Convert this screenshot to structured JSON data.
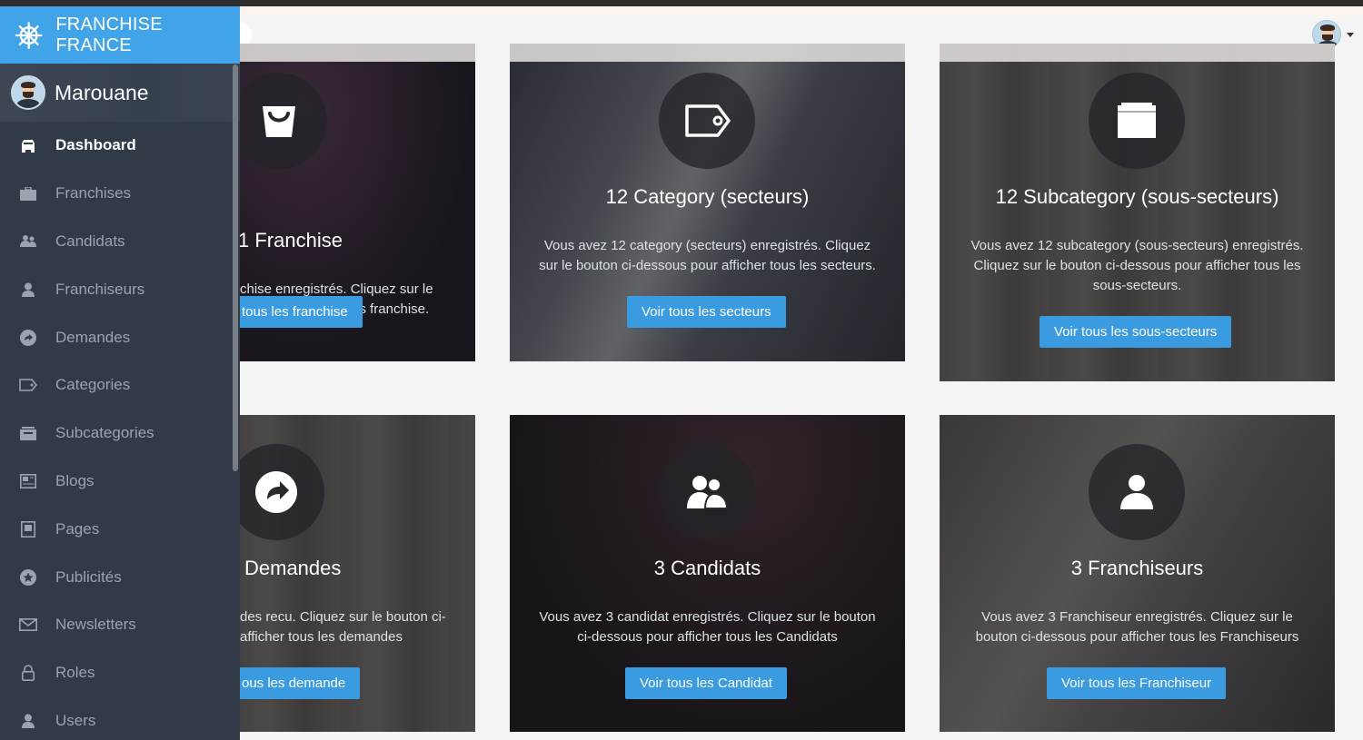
{
  "brand": {
    "name": "FRANCHISE FRANCE"
  },
  "user": {
    "name": "Marouane"
  },
  "nav": [
    {
      "label": "Dashboard",
      "icon": "dashboard-icon",
      "active": true
    },
    {
      "label": "Franchises",
      "icon": "briefcase-icon"
    },
    {
      "label": "Candidats",
      "icon": "users-icon"
    },
    {
      "label": "Franchiseurs",
      "icon": "user-icon"
    },
    {
      "label": "Demandes",
      "icon": "share-icon"
    },
    {
      "label": "Categories",
      "icon": "tag-icon"
    },
    {
      "label": "Subcategories",
      "icon": "inbox-icon"
    },
    {
      "label": "Blogs",
      "icon": "newspaper-icon"
    },
    {
      "label": "Pages",
      "icon": "book-icon"
    },
    {
      "label": "Publicités",
      "icon": "star-icon"
    },
    {
      "label": "Newsletters",
      "icon": "envelope-icon"
    },
    {
      "label": "Roles",
      "icon": "lock-icon"
    },
    {
      "label": "Users",
      "icon": "user-icon"
    }
  ],
  "cards": [
    {
      "title": "1 Franchise",
      "text_line1": "chise enregistrés. Cliquez sur le",
      "text_line2": " pour afficher tous les franchise.",
      "button": "tous les franchise",
      "icon": "shopping-bag-icon"
    },
    {
      "title": "12 Category (secteurs)",
      "text_line1": "Vous avez 12 category (secteurs) enregistrés. Cliquez",
      "text_line2": "sur le bouton ci-dessous pour afficher tous les secteurs.",
      "button": "Voir tous les secteurs",
      "icon": "tag-icon"
    },
    {
      "title": "12 Subcategory (sous-secteurs)",
      "text_line1": "Vous avez 12 subcategory (sous-secteurs) enregistrés.",
      "text_line2": "Cliquez sur le bouton ci-dessous pour afficher tous les",
      "text_line3": "sous-secteurs.",
      "button": "Voir tous les sous-secteurs",
      "icon": "inbox-icon"
    },
    {
      "title": "Demandes",
      "text_line1": "des recu. Cliquez sur le bouton ci-",
      "text_line2": "afficher tous les demandes",
      "button": "ous les demande",
      "icon": "share-icon"
    },
    {
      "title": "3 Candidats",
      "text_line1": "Vous avez 3 candidat enregistrés. Cliquez sur le bouton",
      "text_line2": "ci-dessous pour afficher tous les Candidats",
      "button": "Voir tous les Candidat",
      "icon": "users-icon"
    },
    {
      "title": "3 Franchiseurs",
      "text_line1": "Vous avez 3 Franchiseur enregistrés. Cliquez sur le",
      "text_line2": "bouton ci-dessous pour afficher tous les Franchiseurs",
      "button": "Voir tous les Franchiseur",
      "icon": "user-icon"
    }
  ],
  "colors": {
    "accent": "#42a4e8",
    "button": "#3b9be1",
    "sidebar": "#303b47"
  }
}
